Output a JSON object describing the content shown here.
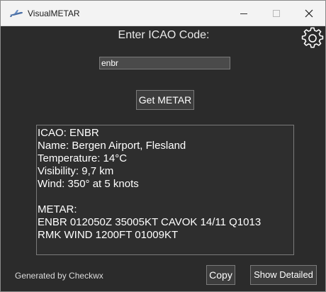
{
  "window": {
    "title": "VisualMETAR",
    "icons": {
      "app": "airplane-icon",
      "minimize": "minimize-icon",
      "maximize": "maximize-icon",
      "close": "close-icon",
      "settings": "gear-icon"
    }
  },
  "form": {
    "heading": "Enter ICAO Code:",
    "icao_value": "enbr",
    "get_button": "Get METAR"
  },
  "result": {
    "icao": "ICAO: ENBR",
    "name": "Name: Bergen Airport, Flesland",
    "temperature": "Temperature: 14°C",
    "visibility": "Visibility: 9,7 km",
    "wind": "Wind: 350° at 5 knots",
    "metar_label": "METAR:",
    "metar_line1": "ENBR 012050Z 35005KT CAVOK 14/11 Q1013",
    "metar_line2": "RMK WIND 1200FT 01009KT"
  },
  "footer": {
    "credit": "Generated by Checkwx",
    "copy_button": "Copy",
    "detail_button": "Show Detailed"
  },
  "colors": {
    "background": "#2b2b2b",
    "titlebar": "#f3f3f3",
    "text": "#ffffff",
    "border": "#7a7a7a"
  }
}
